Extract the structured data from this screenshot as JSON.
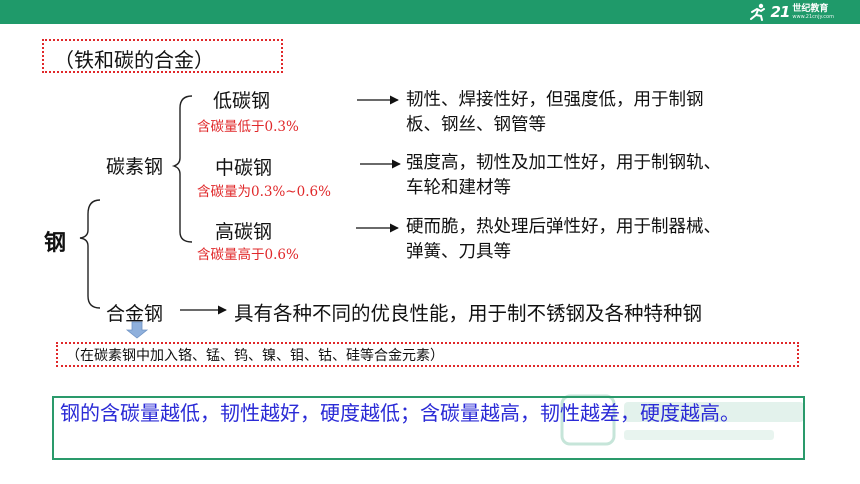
{
  "header": {
    "logo_number": "21",
    "logo_brand": "世纪教育",
    "logo_url": "www.21cnjy.com",
    "bar_color": "#1f9a6a"
  },
  "title": "（铁和碳的合金）",
  "root_label": "钢",
  "carbon_steel": {
    "label": "碳素钢",
    "kinds": [
      {
        "name": "低碳钢",
        "carbon_content": "含碳量低于0.3%",
        "properties_line1": "韧性、焊接性好，但强度低，用于制钢",
        "properties_line2": "板、钢丝、钢管等"
      },
      {
        "name": "中碳钢",
        "carbon_content": "含碳量为0.3%~0.6%",
        "properties_line1": "强度高，韧性及加工性好，用于制钢轨、",
        "properties_line2": "车轮和建材等"
      },
      {
        "name": "高碳钢",
        "carbon_content": "含碳量高于0.6%",
        "properties_line1": "硬而脆，热处理后弹性好，用于制器械、",
        "properties_line2": "弹簧、刀具等"
      }
    ]
  },
  "alloy_steel": {
    "label": "合金钢",
    "properties": "具有各种不同的优良性能，用于制不锈钢及各种特种钢"
  },
  "alloy_note": "（在碳素钢中加入铬、锰、钨、镍、钼、钴、硅等合金元素）",
  "summary": "钢的含碳量越低，韧性越好，硬度越低；含碳量越高，韧性越差，硬度越高。",
  "colors": {
    "accent_red": "#e0282a",
    "summary_blue": "#2b2bd6",
    "arrow_blue": "#8fb0dc"
  }
}
